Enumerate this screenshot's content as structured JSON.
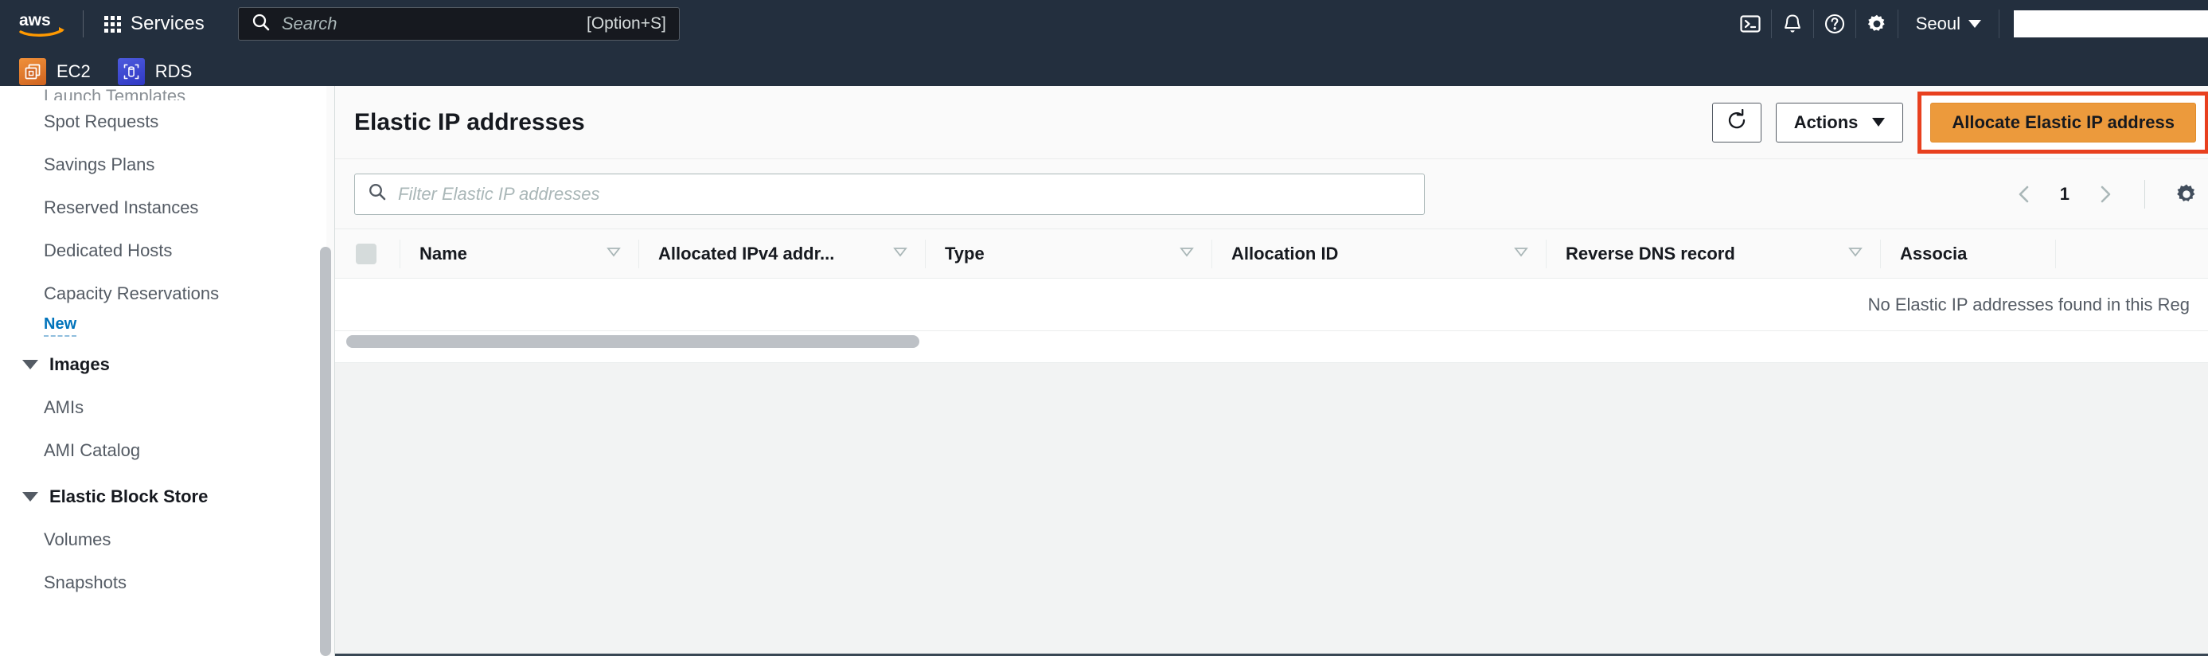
{
  "topnav": {
    "logo_alt": "aws",
    "services_label": "Services",
    "search": {
      "placeholder": "Search",
      "shortcut": "[Option+S]"
    },
    "icons": [
      "cloudshell-icon",
      "notifications-bell-icon",
      "help-question-icon",
      "settings-gear-icon"
    ],
    "region": {
      "label": "Seoul",
      "caret": "▼"
    },
    "account_area": ""
  },
  "favorites": [
    {
      "label": "EC2",
      "icon": "ec2-service-icon"
    },
    {
      "label": "RDS",
      "icon": "rds-service-icon"
    }
  ],
  "sidebar": {
    "clipped_top_item": "Launch Templates",
    "items": [
      {
        "label": "Spot Requests",
        "type": "link"
      },
      {
        "label": "Savings Plans",
        "type": "link"
      },
      {
        "label": "Reserved Instances",
        "type": "link"
      },
      {
        "label": "Dedicated Hosts",
        "type": "link"
      },
      {
        "label": "Capacity Reservations",
        "type": "link"
      }
    ],
    "new_badge": "New",
    "groups": [
      {
        "title": "Images",
        "items": [
          {
            "label": "AMIs"
          },
          {
            "label": "AMI Catalog"
          }
        ]
      },
      {
        "title": "Elastic Block Store",
        "items": [
          {
            "label": "Volumes"
          },
          {
            "label": "Snapshots"
          }
        ]
      }
    ]
  },
  "main": {
    "title": "Elastic IP addresses",
    "buttons": {
      "refresh": "refresh-icon",
      "actions": "Actions",
      "allocate": "Allocate Elastic IP address"
    },
    "filter": {
      "placeholder": "Filter Elastic IP addresses"
    },
    "pagination": {
      "prev": "‹",
      "page": "1",
      "next": "›",
      "settings": "preferences-gear-icon"
    },
    "table": {
      "columns": [
        "Name",
        "Allocated IPv4 addr...",
        "Type",
        "Allocation ID",
        "Reverse DNS record",
        "Associa"
      ],
      "rows": [],
      "empty_message": "No Elastic IP addresses found in this Reg"
    }
  },
  "colors": {
    "nav_bg": "#232f3e",
    "accent_orange": "#ec9a3c",
    "highlight_red": "#e8401f",
    "link_blue": "#0073bb",
    "panel_bg": "#f2f3f3"
  }
}
